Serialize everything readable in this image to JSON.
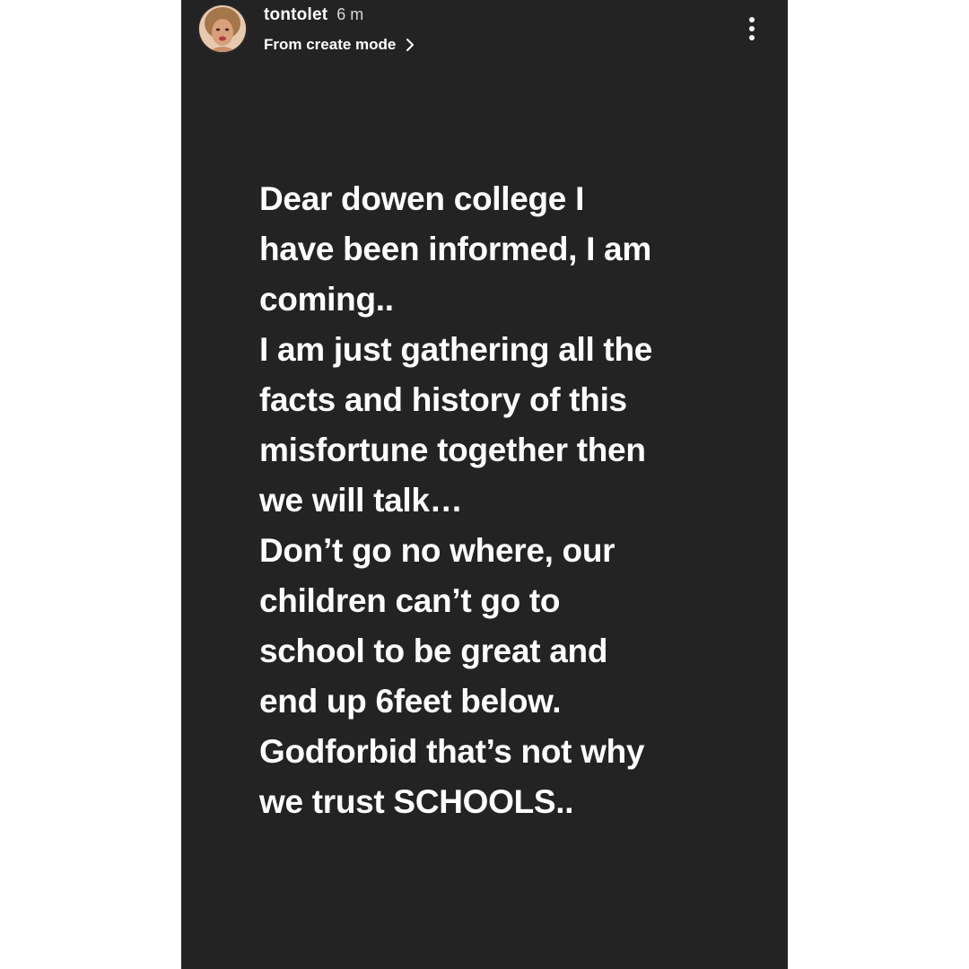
{
  "story": {
    "background_color": "#232323",
    "header": {
      "avatar_icon": "profile-avatar",
      "username": "tontolet",
      "time_ago": "6 m",
      "source_label": "From create mode",
      "source_icon": "chevron-right-icon",
      "more_icon": "more-vertical-icon"
    },
    "text_lines": [
      "Dear dowen college I",
      "have been informed, I am",
      "coming..",
      "I am just gathering all the",
      "facts and history of this",
      "misfortune together then",
      "we will talk…",
      "Don’t go no where, our",
      "children can’t go to",
      "school to be great and",
      "end up 6feet below.",
      "Godforbid that’s not why",
      "we trust SCHOOLS.."
    ]
  }
}
